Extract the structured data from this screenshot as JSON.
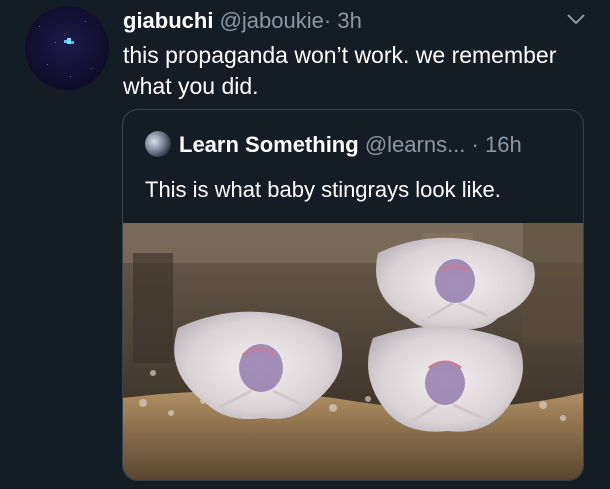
{
  "tweet": {
    "author_name": "giabuchi",
    "author_handle": "@jaboukie",
    "separator": "·",
    "time": "3h",
    "text": "this propaganda won’t work. we remember what you did.",
    "menu_icon": "chevron-down-icon"
  },
  "quoted_tweet": {
    "author_name": "Learn Something",
    "author_handle": "@learns...",
    "separator": "·",
    "time": "16h",
    "text": "This is what baby stingrays look like.",
    "image_content": "baby stingrays in an aquarium"
  },
  "colors": {
    "background": "#141d26",
    "secondary_text": "#8899a6",
    "border": "#38444d"
  }
}
